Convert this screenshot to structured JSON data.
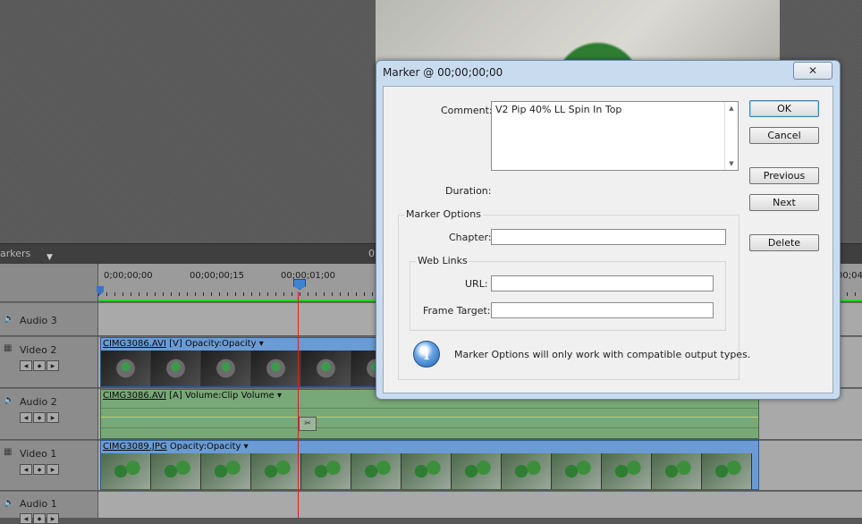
{
  "panel": {
    "markers_tab": "arkers",
    "markers_tab_arrow": "▼",
    "second_tab_partial": "0"
  },
  "ruler": {
    "labels": [
      "0;00;00;00",
      "00;00;00;15",
      "00;00;01;00",
      "00;04"
    ]
  },
  "tracks": {
    "audio3": "Audio 3",
    "video2": "Video 2",
    "audio2": "Audio 2",
    "video1": "Video 1",
    "audio1": "Audio 1"
  },
  "clips": {
    "video2_name": "CIMG3086.AVI",
    "video2_suffix": "[V]  Opacity:Opacity ▾",
    "audio2_name": "CIMG3086.AVI",
    "audio2_suffix": "[A]  Volume:Clip Volume ▾",
    "video1_name": "CIMG3089.JPG",
    "video1_suffix": "Opacity:Opacity ▾"
  },
  "dialog": {
    "title": "Marker @ 00;00;00;00",
    "close_glyph": "✕",
    "comment_label": "Comment:",
    "comment_value": "V2 Pip 40% LL Spin In Top",
    "duration_label": "Duration:",
    "marker_options_legend": "Marker Options",
    "chapter_label": "Chapter:",
    "chapter_value": "",
    "web_links_legend": "Web Links",
    "url_label": "URL:",
    "url_value": "",
    "frame_target_label": "Frame Target:",
    "frame_target_value": "",
    "info_text": "Marker Options will only work with compatible output types.",
    "buttons": {
      "ok": "OK",
      "cancel": "Cancel",
      "previous": "Previous",
      "next": "Next",
      "delete": "Delete"
    }
  }
}
